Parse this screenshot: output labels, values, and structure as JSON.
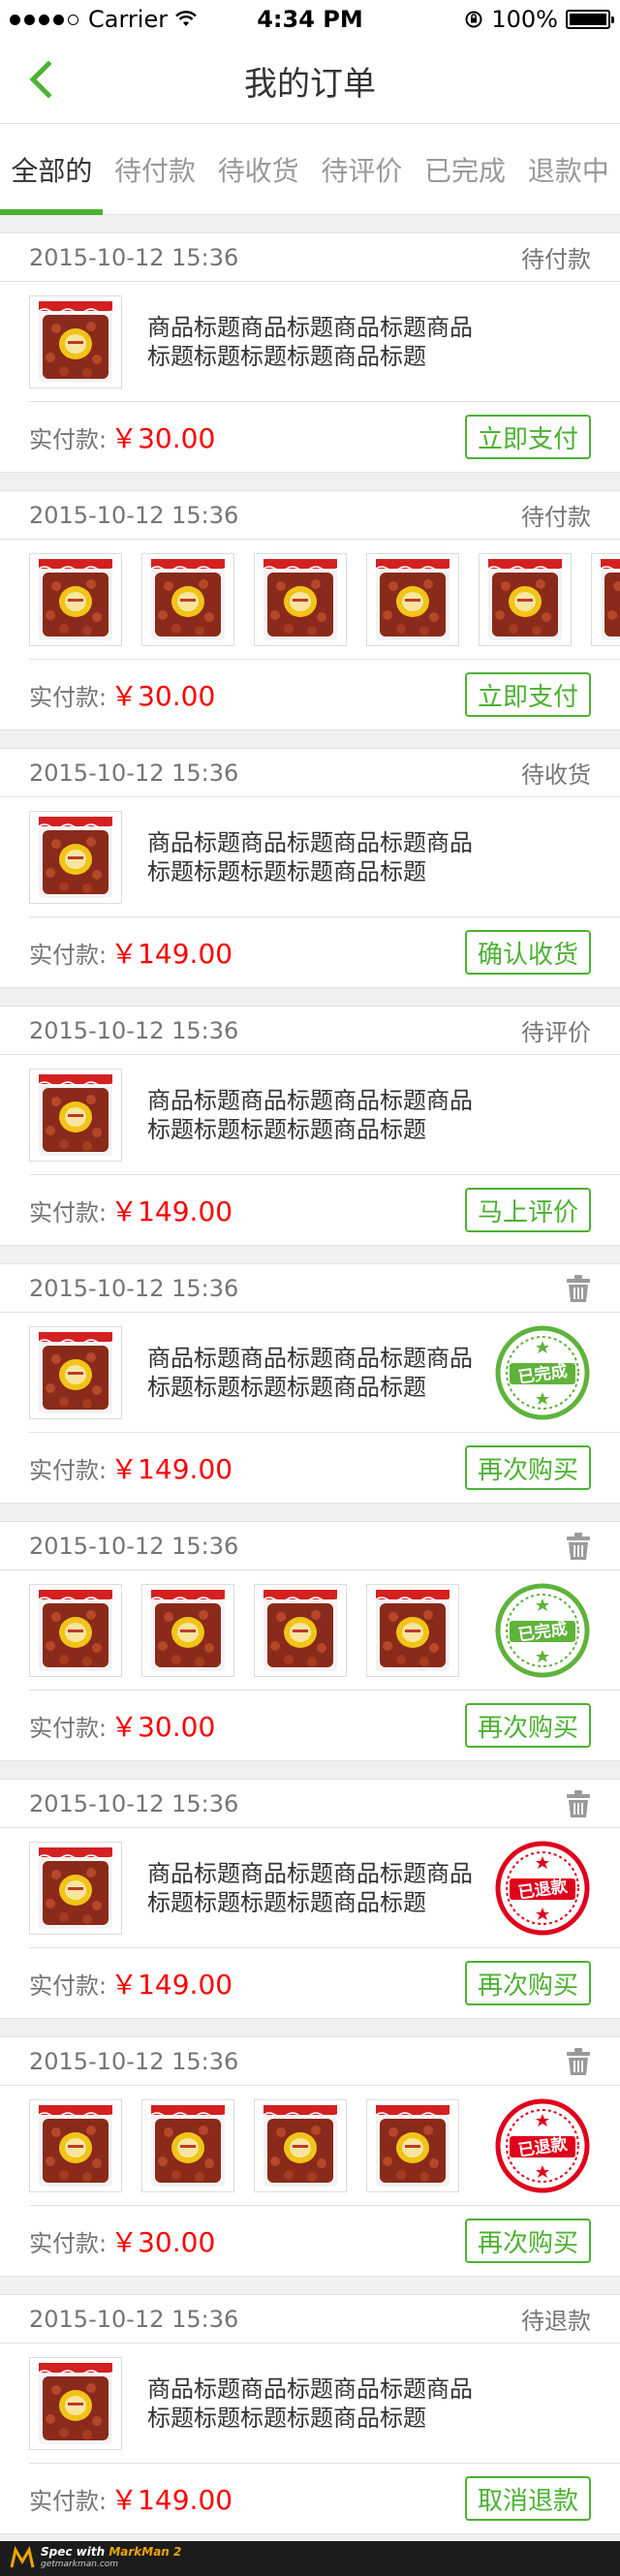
{
  "status_bar": {
    "carrier": "Carrier",
    "time": "4:34 PM",
    "battery": "100%"
  },
  "nav": {
    "title": "我的订单"
  },
  "tabs": [
    {
      "label": "全部的",
      "active": true
    },
    {
      "label": "待付款",
      "active": false
    },
    {
      "label": "待收货",
      "active": false
    },
    {
      "label": "待评价",
      "active": false
    },
    {
      "label": "已完成",
      "active": false
    },
    {
      "label": "退款中",
      "active": false
    }
  ],
  "colors": {
    "accent": "#4cb131",
    "price": "#ff0000",
    "refund_stamp": "#e0001b",
    "done_stamp": "#5fb33b"
  },
  "orders": [
    {
      "date": "2015-10-12 15:36",
      "status": "待付款",
      "trash": false,
      "product_title": "商品标题商品标题商品标题商品标题标题标题标题商品标题",
      "thumb_count": 1,
      "stamp": "",
      "paid_label": "实付款:",
      "amount": "￥30.00",
      "button": "立即支付"
    },
    {
      "date": "2015-10-12 15:36",
      "status": "待付款",
      "trash": false,
      "product_title": "",
      "thumb_count": 6,
      "stamp": "",
      "paid_label": "实付款:",
      "amount": "￥30.00",
      "button": "立即支付"
    },
    {
      "date": "2015-10-12 15:36",
      "status": "待收货",
      "trash": false,
      "product_title": "商品标题商品标题商品标题商品标题标题标题标题商品标题",
      "thumb_count": 1,
      "stamp": "",
      "paid_label": "实付款:",
      "amount": "￥149.00",
      "button": "确认收货"
    },
    {
      "date": "2015-10-12 15:36",
      "status": "待评价",
      "trash": false,
      "product_title": "商品标题商品标题商品标题商品标题标题标题标题商品标题",
      "thumb_count": 1,
      "stamp": "",
      "paid_label": "实付款:",
      "amount": "￥149.00",
      "button": "马上评价"
    },
    {
      "date": "2015-10-12 15:36",
      "status": "",
      "trash": true,
      "product_title": "商品标题商品标题商品标题商品标题标题标题标题商品标题",
      "thumb_count": 1,
      "stamp": "已完成",
      "paid_label": "实付款:",
      "amount": "￥149.00",
      "button": "再次购买"
    },
    {
      "date": "2015-10-12 15:36",
      "status": "",
      "trash": true,
      "product_title": "",
      "thumb_count": 4,
      "stamp": "已完成",
      "paid_label": "实付款:",
      "amount": "￥30.00",
      "button": "再次购买"
    },
    {
      "date": "2015-10-12 15:36",
      "status": "",
      "trash": true,
      "product_title": "商品标题商品标题商品标题商品标题标题标题标题商品标题",
      "thumb_count": 1,
      "stamp": "已退款",
      "paid_label": "实付款:",
      "amount": "￥149.00",
      "button": "再次购买"
    },
    {
      "date": "2015-10-12 15:36",
      "status": "",
      "trash": true,
      "product_title": "",
      "thumb_count": 4,
      "stamp": "已退款",
      "paid_label": "实付款:",
      "amount": "￥30.00",
      "button": "再次购买"
    },
    {
      "date": "2015-10-12 15:36",
      "status": "待退款",
      "trash": false,
      "product_title": "商品标题商品标题商品标题商品标题标题标题标题商品标题",
      "thumb_count": 1,
      "stamp": "",
      "paid_label": "实付款:",
      "amount": "￥149.00",
      "button": "取消退款"
    }
  ],
  "footer_watermark": {
    "line1_prefix": "Spec with ",
    "brand": "MarkMan 2",
    "line2": "getmarkman.com"
  }
}
